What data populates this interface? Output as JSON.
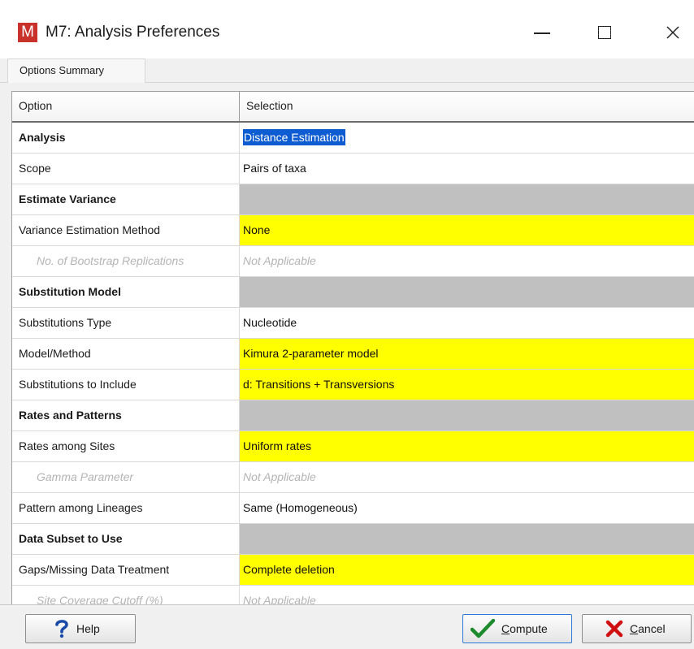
{
  "window": {
    "app_icon_letter": "M",
    "title": "M7: Analysis Preferences",
    "close_glyph": "✕"
  },
  "tabs": [
    {
      "label": "Options Summary",
      "selected": true
    }
  ],
  "grid": {
    "columns": [
      "Option",
      "Selection"
    ],
    "rows": [
      {
        "option": "Analysis",
        "selection": "Distance Estimation",
        "style": "bold",
        "selection_fill": "none",
        "selected": true
      },
      {
        "option": "Scope",
        "selection": "Pairs of taxa",
        "style": "normal",
        "selection_fill": "none"
      },
      {
        "option": "Estimate Variance",
        "selection": "",
        "style": "bold",
        "selection_fill": "gray"
      },
      {
        "option": "Variance Estimation Method",
        "selection": "None",
        "style": "normal",
        "selection_fill": "yellow"
      },
      {
        "option": "No. of Bootstrap Replications",
        "selection": "Not Applicable",
        "style": "disabled",
        "selection_fill": "none"
      },
      {
        "option": "Substitution Model",
        "selection": "",
        "style": "bold",
        "selection_fill": "gray"
      },
      {
        "option": "Substitutions Type",
        "selection": "Nucleotide",
        "style": "normal",
        "selection_fill": "none"
      },
      {
        "option": "Model/Method",
        "selection": "Kimura 2-parameter model",
        "style": "normal",
        "selection_fill": "yellow"
      },
      {
        "option": "Substitutions to Include",
        "selection": "d: Transitions + Transversions",
        "style": "normal",
        "selection_fill": "yellow"
      },
      {
        "option": "Rates and Patterns",
        "selection": "",
        "style": "bold",
        "selection_fill": "gray"
      },
      {
        "option": "Rates among Sites",
        "selection": "Uniform rates",
        "style": "normal",
        "selection_fill": "yellow"
      },
      {
        "option": "Gamma Parameter",
        "selection": "Not Applicable",
        "style": "disabled",
        "selection_fill": "none"
      },
      {
        "option": "Pattern among Lineages",
        "selection": "Same (Homogeneous)",
        "style": "normal",
        "selection_fill": "none"
      },
      {
        "option": "Data Subset to Use",
        "selection": "",
        "style": "bold",
        "selection_fill": "gray"
      },
      {
        "option": "Gaps/Missing Data Treatment",
        "selection": "Complete deletion",
        "style": "normal",
        "selection_fill": "yellow"
      },
      {
        "option": "Site Coverage Cutoff (%)",
        "selection": "Not Applicable",
        "style": "disabled",
        "selection_fill": "none"
      }
    ]
  },
  "buttons": {
    "help": {
      "label": "Help",
      "icon": "question-icon"
    },
    "compute": {
      "label_first": "C",
      "label_rest": "ompute",
      "icon": "checkmark-icon"
    },
    "cancel": {
      "label_first": "C",
      "label_rest": "ancel",
      "icon": "x-icon"
    }
  },
  "colors": {
    "logo": "#c8322a",
    "highlight_yellow": "#ffff00",
    "section_gray": "#c0c0c0",
    "selection_blue": "#0d5cd1",
    "compute_check": "#1e8a2e"
  }
}
